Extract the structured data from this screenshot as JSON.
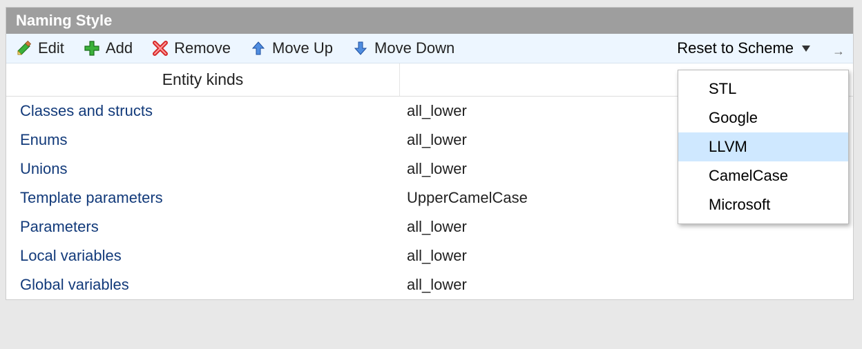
{
  "title": "Naming Style",
  "toolbar": {
    "edit": "Edit",
    "add": "Add",
    "remove": "Remove",
    "moveUp": "Move Up",
    "moveDown": "Move Down",
    "reset": "Reset to Scheme"
  },
  "dropdown": {
    "items": [
      "STL",
      "Google",
      "LLVM",
      "CamelCase",
      "Microsoft"
    ],
    "hoverIndex": 2
  },
  "columns": {
    "kind": "Entity kinds",
    "style": ""
  },
  "rows": [
    {
      "kind": "Classes and structs",
      "style": "all_lower"
    },
    {
      "kind": "Enums",
      "style": "all_lower"
    },
    {
      "kind": "Unions",
      "style": "all_lower"
    },
    {
      "kind": "Template parameters",
      "style": "UpperCamelCase"
    },
    {
      "kind": "Parameters",
      "style": "all_lower"
    },
    {
      "kind": "Local variables",
      "style": "all_lower"
    },
    {
      "kind": "Global variables",
      "style": "all_lower"
    }
  ]
}
